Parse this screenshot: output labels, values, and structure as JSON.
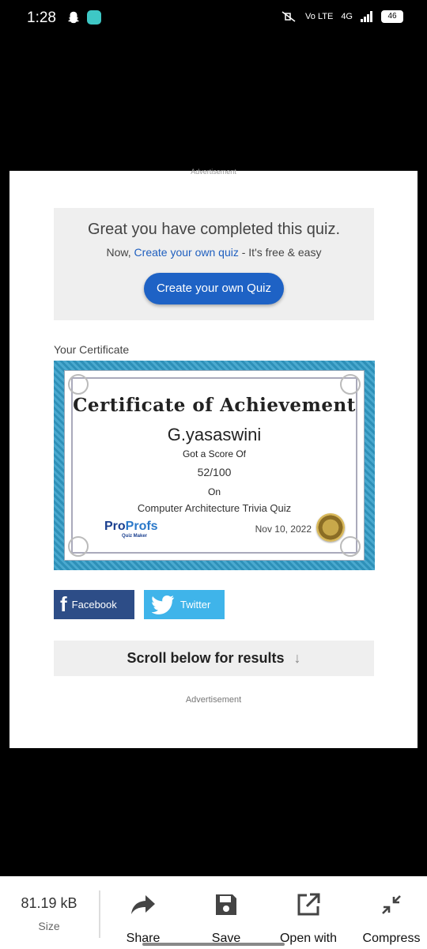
{
  "status_bar": {
    "time": "1:28",
    "network": "Vo LTE",
    "signal": "4G",
    "battery": "46"
  },
  "page": {
    "ad_top": "Advertisement",
    "promo": {
      "heading": "Great you have completed this quiz.",
      "sub_prefix": "Now,",
      "sub_link": "Create your own quiz",
      "sub_suffix": "- It's free & easy",
      "button": "Create your own Quiz"
    },
    "certificate_label": "Your Certificate",
    "certificate": {
      "title": "Certificate of Achievement",
      "name": "G.yasaswini",
      "score_label": "Got a Score Of",
      "score": "52/100",
      "on_label": "On",
      "quiz": "Computer Architecture Trivia Quiz",
      "date": "Nov 10, 2022",
      "logo_pro": "Pro",
      "logo_profs": "Profs",
      "logo_tag": "Quiz Maker"
    },
    "share": {
      "facebook": "Facebook",
      "twitter": "Twitter"
    },
    "scroll_text": "Scroll below for results",
    "scroll_arrow": "↓",
    "ad_bottom": "Advertisement"
  },
  "action_bar": {
    "size_value": "81.19 kB",
    "size_label": "Size",
    "actions": [
      {
        "label": "Share",
        "icon": "share-icon"
      },
      {
        "label": "Save",
        "icon": "save-icon"
      },
      {
        "label": "Open with",
        "icon": "open-with-icon"
      },
      {
        "label": "Compress",
        "icon": "compress-icon"
      }
    ]
  }
}
